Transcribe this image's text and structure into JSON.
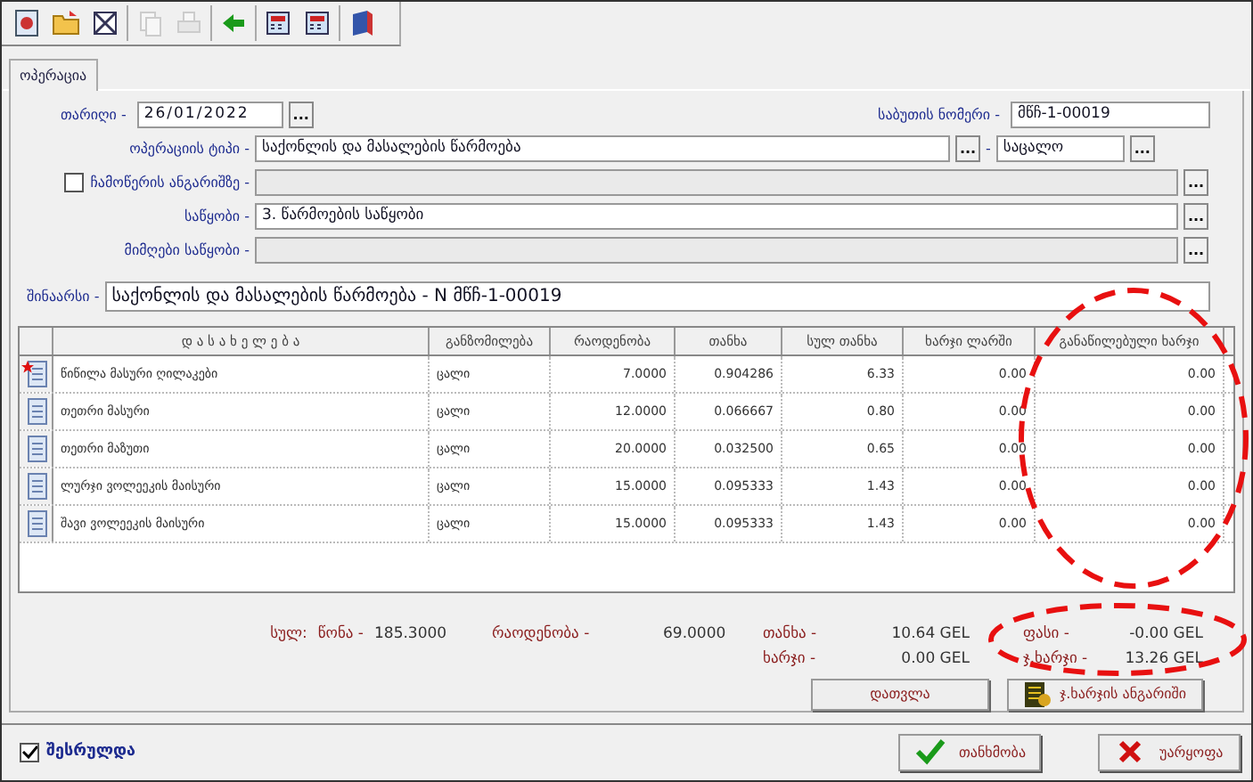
{
  "toolbar": {
    "buttons": [
      {
        "kind": "new",
        "disabled": false
      },
      {
        "kind": "open",
        "disabled": false
      },
      {
        "kind": "delete",
        "disabled": false
      },
      {
        "kind": "copy",
        "disabled": true
      },
      {
        "kind": "print",
        "disabled": true
      },
      {
        "kind": "back",
        "disabled": false
      },
      {
        "kind": "calc",
        "disabled": false
      },
      {
        "kind": "calc",
        "disabled": false
      },
      {
        "kind": "book",
        "disabled": false
      }
    ]
  },
  "tabs": [
    {
      "label": "ოპერაცია",
      "selected": true
    }
  ],
  "form": {
    "date_label": "თარიღი -",
    "date": "26/01/2022",
    "doc_label": "საბუთის ნომერი -",
    "doc_number": "მწჩ-1-00019",
    "op_label": "ოპერაციის ტიპი -",
    "op_value": "საქონლის და მასალების წარმოება",
    "op_sep": "-",
    "op_extra": "საცალო",
    "account_label": "ჩამოწერის ანგარიშზე -",
    "account_checked": false,
    "store_label": "საწყობი -",
    "store_value": "3. წარმოების საწყობი",
    "receiver_label": "მიმღები საწყობი -",
    "content_label": "შინაარსი -",
    "content_value": "საქონლის და მასალების წარმოება - N მწჩ-1-00019"
  },
  "table": {
    "columns": [
      "დ ა ს ა ხ ე ლ ე ბ ა",
      "განზომილება",
      "რაოდენობა",
      "თანხა",
      "სულ თანხა",
      "ხარჯი ლარში",
      "განაწილებული ხარჯი"
    ],
    "rows": [
      {
        "marked": true,
        "cells": [
          "წიწილა მასური ღილაკები",
          "ცალი",
          "7.0000",
          "0.904286",
          "6.33",
          "0.00",
          "0.00"
        ]
      },
      {
        "marked": false,
        "cells": [
          "თეთრი მასური",
          "ცალი",
          "12.0000",
          "0.066667",
          "0.80",
          "0.00",
          "0.00"
        ]
      },
      {
        "marked": false,
        "cells": [
          "თეთრი მაზუთი",
          "ცალი",
          "20.0000",
          "0.032500",
          "0.65",
          "0.00",
          "0.00"
        ]
      },
      {
        "marked": false,
        "cells": [
          "ლურჯი ვოლეეკის მაისური",
          "ცალი",
          "15.0000",
          "0.095333",
          "1.43",
          "0.00",
          "0.00"
        ]
      },
      {
        "marked": false,
        "cells": [
          "შავი ვოლეეკის მაისური",
          "ცალი",
          "15.0000",
          "0.095333",
          "1.43",
          "0.00",
          "0.00"
        ]
      }
    ]
  },
  "totals": {
    "sum_label": "სულ:",
    "weight_label": "წონა -",
    "weight": "185.3000",
    "qty_label": "რაოდენობა -",
    "qty": "69.0000",
    "amount_label": "თანხა -",
    "amount": "10.64 GEL",
    "price_label": "ფასი -",
    "price": "-0.00 GEL",
    "cost_label": "ხარჯი -",
    "cost": "0.00 GEL",
    "tcost_label": "ჯ.ხარჯი -",
    "tcost": "13.26 GEL"
  },
  "panel_buttons": [
    "დათვლა",
    "ჯ.ხარჯის ანგარიში"
  ],
  "footer": {
    "done_label": "შესრულდა",
    "done_checked": true,
    "ok": "თანხმობა",
    "cancel": "უარყოფა"
  },
  "ellipsis_buttons": [
    "...",
    "...",
    "...",
    "...",
    "...",
    "..."
  ],
  "annotations": [
    {
      "kind": "circle"
    },
    {
      "kind": "circle"
    }
  ]
}
